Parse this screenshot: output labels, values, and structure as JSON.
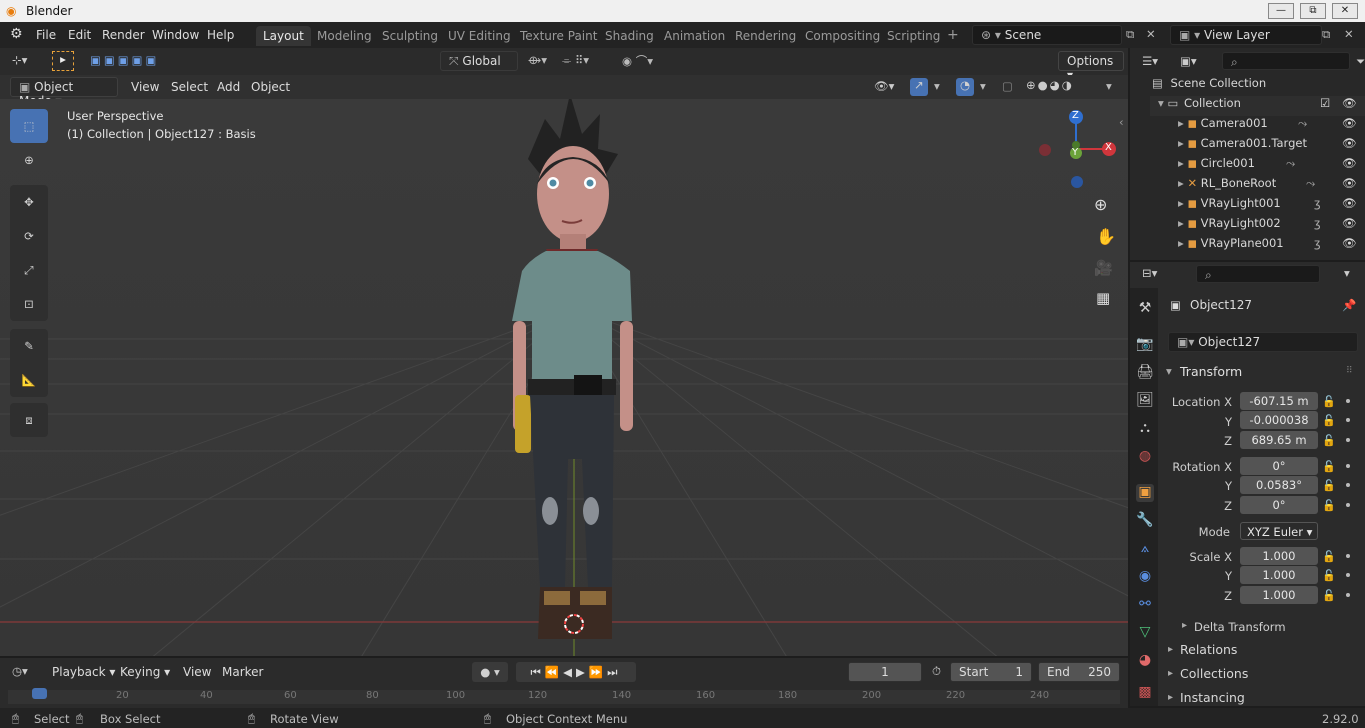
{
  "window": {
    "title": "Blender",
    "min": "—",
    "max": "⧉",
    "close": "✕"
  },
  "menu": [
    "File",
    "Edit",
    "Render",
    "Window",
    "Help"
  ],
  "workspaces": [
    "Layout",
    "Modeling",
    "Sculpting",
    "UV Editing",
    "Texture Paint",
    "Shading",
    "Animation",
    "Rendering",
    "Compositing",
    "Scripting"
  ],
  "workspace_plus": "+",
  "scene": "Scene",
  "view_layer": "View Layer",
  "header": {
    "transform": "Global",
    "options": "Options"
  },
  "viewport_header": {
    "mode": "Object Mode",
    "items": [
      "View",
      "Select",
      "Add",
      "Object"
    ]
  },
  "viewport": {
    "line1": "User Perspective",
    "line2": "(1) Collection | Object127 : Basis"
  },
  "gizmo": {
    "x": "X",
    "y": "Y",
    "z": "Z"
  },
  "outliner": {
    "root": "Scene Collection",
    "collection": "Collection",
    "items": [
      "Camera001",
      "Camera001.Target",
      "Circle001",
      "RL_BoneRoot",
      "VRayLight001",
      "VRayLight002",
      "VRayPlane001"
    ]
  },
  "props": {
    "object": "Object127",
    "data_object": "Object127",
    "transform": "Transform",
    "location": {
      "label": "Location X",
      "x": "-607.15 m",
      "y": "-0.000038",
      "z": "689.65 m"
    },
    "rotation": {
      "label": "Rotation X",
      "x": "0°",
      "y": "0.0583°",
      "z": "0°"
    },
    "mode_label": "Mode",
    "mode": "XYZ Euler",
    "scale": {
      "label": "Scale X",
      "x": "1.000",
      "y": "1.000",
      "z": "1.000"
    },
    "y": "Y",
    "z": "Z",
    "delta": "Delta Transform",
    "relations": "Relations",
    "collections": "Collections",
    "instancing": "Instancing"
  },
  "timeline": {
    "playback": "Playback",
    "keying": "Keying",
    "view": "View",
    "marker": "Marker",
    "frame": "1",
    "start_label": "Start",
    "start": "1",
    "end_label": "End",
    "end": "250",
    "ruler": [
      "0",
      "20",
      "40",
      "60",
      "80",
      "100",
      "120",
      "140",
      "160",
      "180",
      "200",
      "220",
      "240"
    ]
  },
  "status": {
    "select": "Select",
    "box": "Box Select",
    "rotate": "Rotate View",
    "context": "Object Context Menu",
    "version": "2.92.0"
  }
}
